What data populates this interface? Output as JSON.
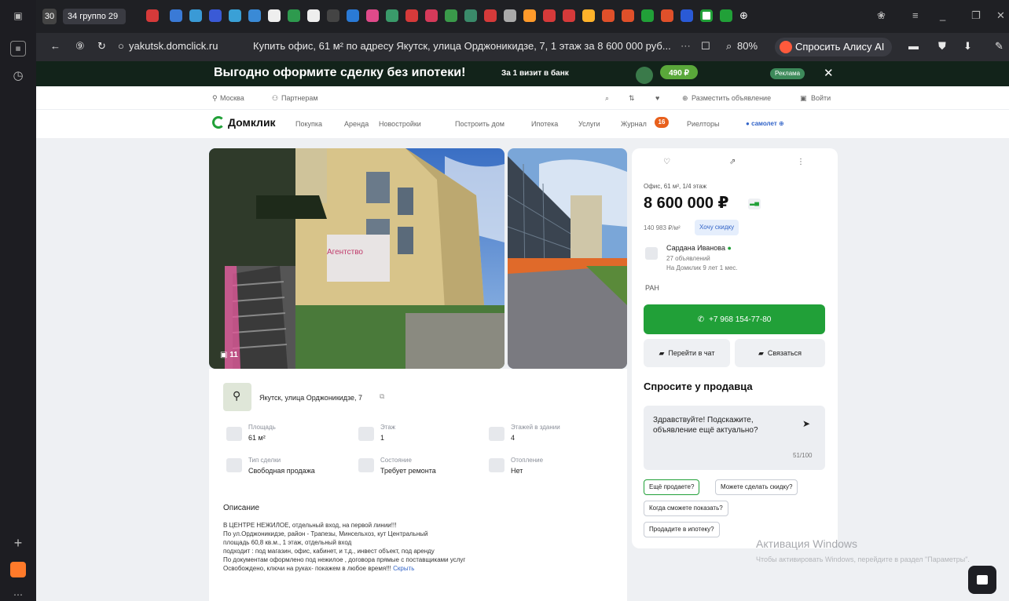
{
  "tabs": {
    "count_label": "30",
    "group_label": "34 группо 29"
  },
  "address_bar": {
    "domain": "yakutsk.domclick.ru",
    "page_title": "Купить офис, 61 м² по адресу Якутск, улица Орджоникидзе, 7, 1 этаж за 8 600 000 руб...",
    "zoom": "80%",
    "alice_button": "Спросить Алису AI"
  },
  "ad_banner": {
    "title": "Выгодно оформите сделку без ипотеки!",
    "subtitle": "За 1 визит в банк",
    "price_badge": "490 ₽",
    "ad_label": "Реклама",
    "close": "✕"
  },
  "utility_bar": {
    "city": "Москва",
    "partners": "Партнерам",
    "post_ad": "Разместить объявление",
    "login": "Войти"
  },
  "nav": {
    "logo": "Домклик",
    "items": [
      "Покупка",
      "Аренда",
      "Новостройки",
      "Построить дом",
      "Ипотека",
      "Услуги",
      "Журнал",
      "Риелторы"
    ],
    "journal_badge": "16",
    "samolet": "самолет"
  },
  "photos": {
    "count": "11"
  },
  "listing": {
    "address": "Якутск, улица Орджоникидзе, 7",
    "features": [
      {
        "label": "Площадь",
        "value": "61 м²"
      },
      {
        "label": "Этаж",
        "value": "1"
      },
      {
        "label": "Этажей в здании",
        "value": "4"
      },
      {
        "label": "Тип сделки",
        "value": "Свободная продажа"
      },
      {
        "label": "Состояние",
        "value": "Требует ремонта"
      },
      {
        "label": "Отопление",
        "value": "Нет"
      }
    ],
    "description_title": "Описание",
    "description_lines": [
      "В ЦЕНТРЕ НЕЖИЛОЕ, отдельный вход, на первой линии!!!",
      "По ул.Орджоникидзе, район - Трапезы, Минсельхоз, кут Центральный",
      "площадь 60,8 кв.м., 1 этаж, отдельный вход",
      "подходит : под магазин, офис, кабинет, и т.д., инвест объект, под аренду",
      "По документам оформлено под нежилое , договора прямые с поставщиками услуг",
      "Освобождено, ключи на руках- покажем в любое время!!!"
    ],
    "hide_link": "Скрыть"
  },
  "card": {
    "subtitle": "Офис, 61 м², 1/4 этаж",
    "price": "8 600 000 ₽",
    "price_per_m": "140 983 ₽/м²",
    "discount_button": "Хочу скидку",
    "agent_name": "Сардана Иванова",
    "agent_ads": "27 объявлений",
    "agent_since": "На Домклик 9 лет 1 мес.",
    "agency_label": "РАН",
    "phone": "+7 968 154-77-80",
    "chat_button": "Перейти в чат",
    "contact_button": "Связаться",
    "ask_title": "Спросите у продавца",
    "message": "Здравствуйте! Подскажите, объявление ещё актуально?",
    "message_counter": "51/100",
    "quick_replies": [
      "Ещё продаете?",
      "Можете сделать скидку?",
      "Когда сможете показать?",
      "Продадите в ипотеку?"
    ]
  },
  "windows_watermark": {
    "title": "Активация Windows",
    "text": "Чтобы активировать Windows, перейдите в раздел \"Параметры\"."
  }
}
